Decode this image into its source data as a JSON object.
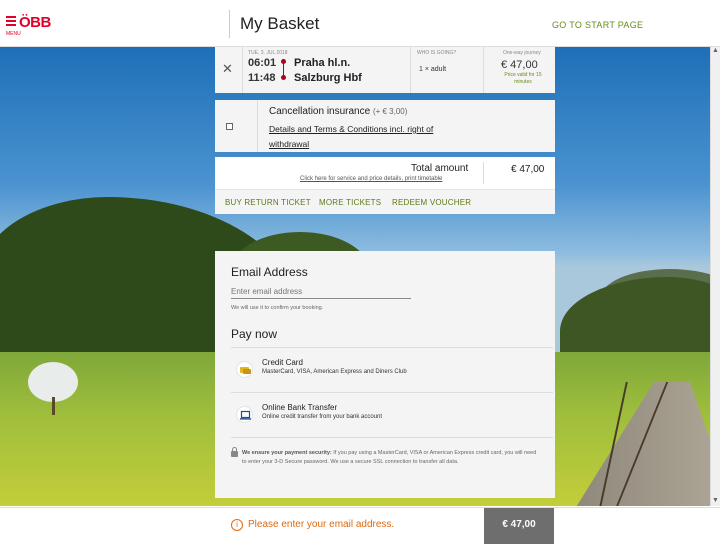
{
  "header": {
    "logo_text": "ÖBB",
    "menu_label": "MENU",
    "title": "My Basket",
    "start_link": "GO TO START PAGE"
  },
  "trip": {
    "date": "TUE, 3. JUL 2018",
    "departure_time": "06:01",
    "arrival_time": "11:48",
    "from": "Praha hl.n.",
    "to": "Salzburg Hbf",
    "who_label": "WHO IS GOING?",
    "who_value": "1 × adult",
    "oneway_label": "One-way journey",
    "price": "€ 47,00",
    "price_valid": "Price valid for 15 minutes"
  },
  "insurance": {
    "title": "Cancellation insurance",
    "extra": "(+ € 3,00)",
    "link": "Details and Terms & Conditions incl. right of withdrawal"
  },
  "total": {
    "label": "Total amount",
    "link": "Click here for service and price details, print timetable",
    "amount": "€ 47,00"
  },
  "actions": {
    "return": "BUY RETURN TICKET",
    "more": "MORE TICKETS",
    "voucher": "REDEEM VOUCHER"
  },
  "email": {
    "title": "Email Address",
    "placeholder": "Enter email address",
    "hint": "We will use it to confirm your booking."
  },
  "payment": {
    "title": "Pay now",
    "options": [
      {
        "title": "Credit Card",
        "subtitle": "MasterCard, VISA, American Express and Diners Club",
        "icon": "credit-card-icon"
      },
      {
        "title": "Online Bank Transfer",
        "subtitle": "Online credit transfer from your bank account",
        "icon": "laptop-icon"
      }
    ],
    "security_bold": "We ensure your payment security:",
    "security_text": "If you pay using a MasterCard, VISA or American Express credit card, you will need to enter your 3-D Secure password. We use a secure SSL connection to transfer all data."
  },
  "footer": {
    "warning": "Please enter your email address.",
    "price": "€ 47,00"
  },
  "colors": {
    "brand_red": "#e2002a",
    "link_green": "#6a8a1c",
    "warning_orange": "#e06a10"
  }
}
